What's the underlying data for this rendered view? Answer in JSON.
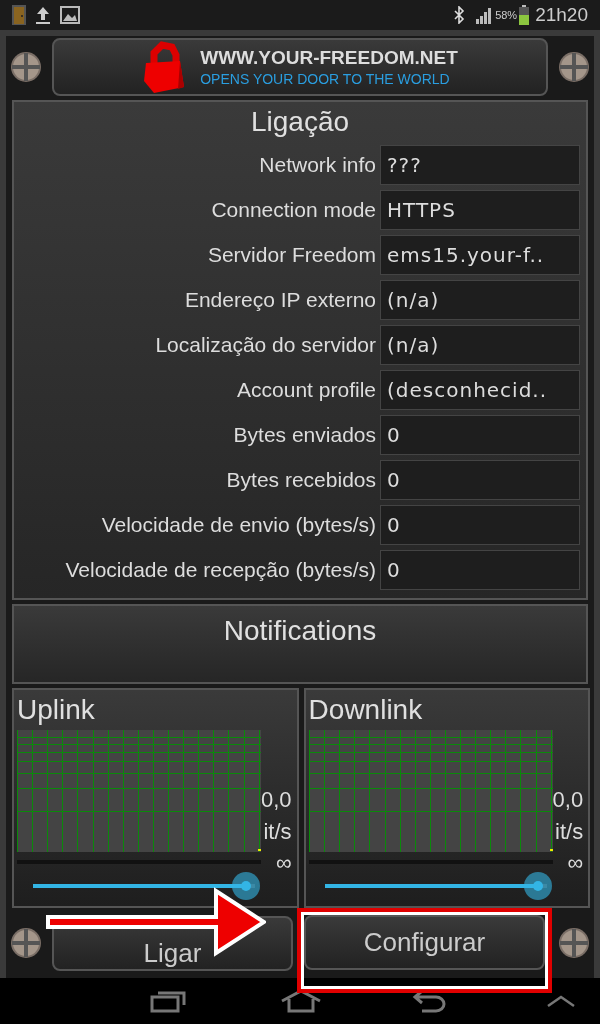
{
  "status_bar": {
    "battery_percent": "58%",
    "time": "21h20"
  },
  "banner": {
    "title": "WWW.YOUR-FREEDOM.NET",
    "tagline": "OPENS YOUR DOOR TO THE WORLD"
  },
  "connection": {
    "title": "Ligação",
    "rows": [
      {
        "label": "Network info",
        "value": "???"
      },
      {
        "label": "Connection mode",
        "value": "HTTPS"
      },
      {
        "label": "Servidor Freedom",
        "value": "ems15.your-f.."
      },
      {
        "label": "Endereço IP externo",
        "value": "(n/a)"
      },
      {
        "label": "Localização do servidor",
        "value": "(n/a)"
      },
      {
        "label": "Account profile",
        "value": "(desconhecid.."
      },
      {
        "label": "Bytes enviados",
        "value": "0"
      },
      {
        "label": "Bytes recebidos",
        "value": "0"
      },
      {
        "label": "Velocidade de envio (bytes/s)",
        "value": "0"
      },
      {
        "label": "Velocidade de recepção (bytes/s)",
        "value": "0"
      }
    ]
  },
  "notifications": {
    "title": "Notifications"
  },
  "meters": [
    {
      "title": "Uplink",
      "rate": "0,0",
      "unit": "it/s",
      "limit": "∞",
      "level": 0.96
    },
    {
      "title": "Downlink",
      "rate": "0,0",
      "unit": "it/s",
      "limit": "∞",
      "level": 0.96
    }
  ],
  "buttons": [
    {
      "label": "Ligar",
      "highlighted": false
    },
    {
      "label": "Configurar",
      "highlighted": true
    }
  ]
}
